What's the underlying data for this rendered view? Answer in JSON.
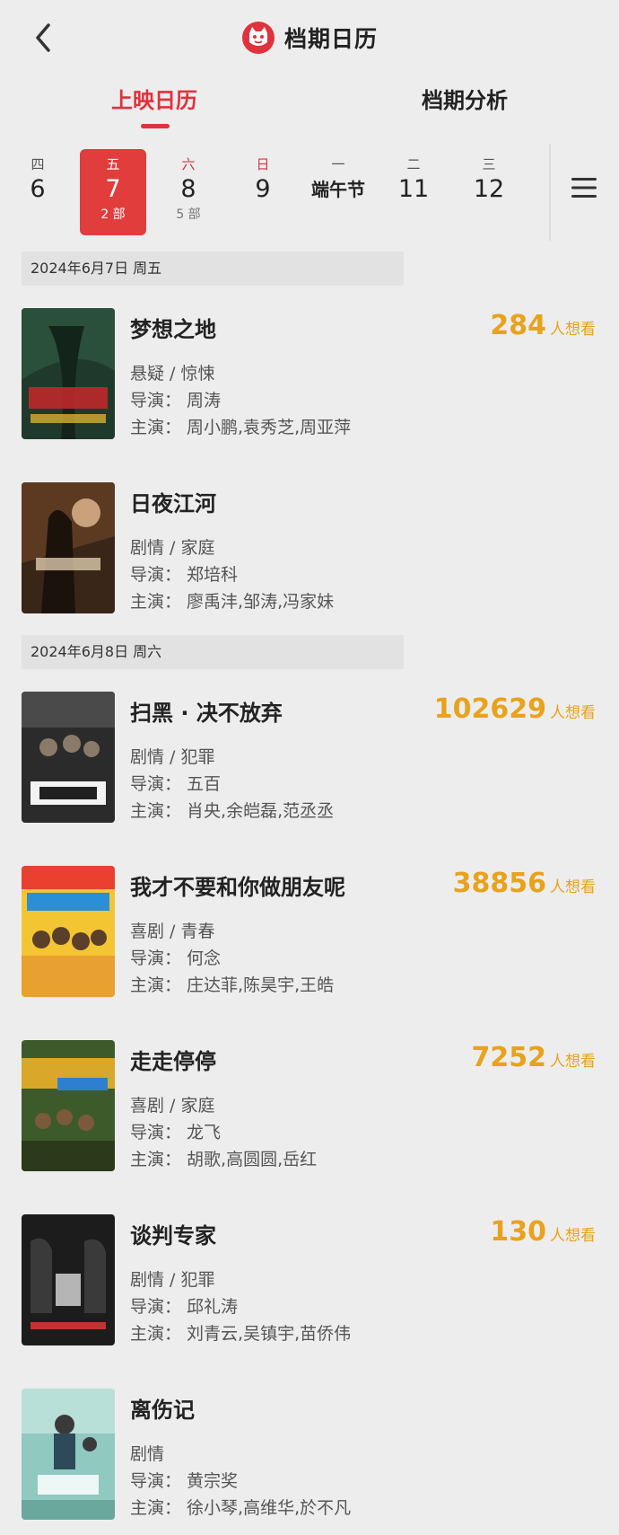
{
  "header": {
    "title": "档期日历",
    "logo_icon": "cat-logo-icon",
    "back_icon": "back-arrow-icon"
  },
  "tabs": [
    {
      "label": "上映日历",
      "active": true
    },
    {
      "label": "档期分析",
      "active": false
    }
  ],
  "date_strip": [
    {
      "weekday": "四",
      "day": "6",
      "count": "",
      "active": false
    },
    {
      "weekday": "五",
      "day": "7",
      "count": "2 部",
      "active": true
    },
    {
      "weekday": "六",
      "day": "8",
      "count": "5 部",
      "active": false
    },
    {
      "weekday": "日",
      "day": "9",
      "count": "",
      "active": false
    },
    {
      "weekday": "一",
      "day": "端午节",
      "count": "",
      "active": false
    },
    {
      "weekday": "二",
      "day": "11",
      "count": "",
      "active": false
    },
    {
      "weekday": "三",
      "day": "12",
      "count": "",
      "active": false
    }
  ],
  "sections": [
    {
      "date_label": "2024年6月7日   周五",
      "movies": [
        {
          "title": "梦想之地",
          "genre": "悬疑 / 惊悚",
          "director": "导演：  周涛",
          "cast": "主演：  周小鹏,袁秀芝,周亚萍",
          "want_count": "284",
          "want_unit": "人想看"
        },
        {
          "title": "日夜江河",
          "genre": "剧情 / 家庭",
          "director": "导演：  郑培科",
          "cast": "主演：  廖禹沣,邹涛,冯家妹",
          "want_count": "",
          "want_unit": ""
        }
      ]
    },
    {
      "date_label": "2024年6月8日   周六",
      "movies": [
        {
          "title": "扫黑 · 决不放弃",
          "genre": "剧情 / 犯罪",
          "director": "导演：  五百",
          "cast": "主演：  肖央,余皑磊,范丞丞",
          "want_count": "102629",
          "want_unit": "人想看"
        },
        {
          "title": "我才不要和你做朋友呢",
          "genre": "喜剧 / 青春",
          "director": "导演：  何念",
          "cast": "主演：  庄达菲,陈昊宇,王皓",
          "want_count": "38856",
          "want_unit": "人想看"
        },
        {
          "title": "走走停停",
          "genre": "喜剧 / 家庭",
          "director": "导演：  龙飞",
          "cast": "主演：  胡歌,高圆圆,岳红",
          "want_count": "7252",
          "want_unit": "人想看"
        },
        {
          "title": "谈判专家",
          "genre": "剧情 / 犯罪",
          "director": "导演：  邱礼涛",
          "cast": "主演：  刘青云,吴镇宇,苗侨伟",
          "want_count": "130",
          "want_unit": "人想看"
        },
        {
          "title": "离伤记",
          "genre": "剧情",
          "director": "导演：  黄宗奖",
          "cast": "主演：  徐小琴,高维华,於不凡",
          "want_count": "",
          "want_unit": ""
        }
      ]
    }
  ],
  "colors": {
    "accent": "#e0323c",
    "want": "#e8a21c",
    "background": "#ededed"
  },
  "menu_icon": "hamburger-menu-icon"
}
